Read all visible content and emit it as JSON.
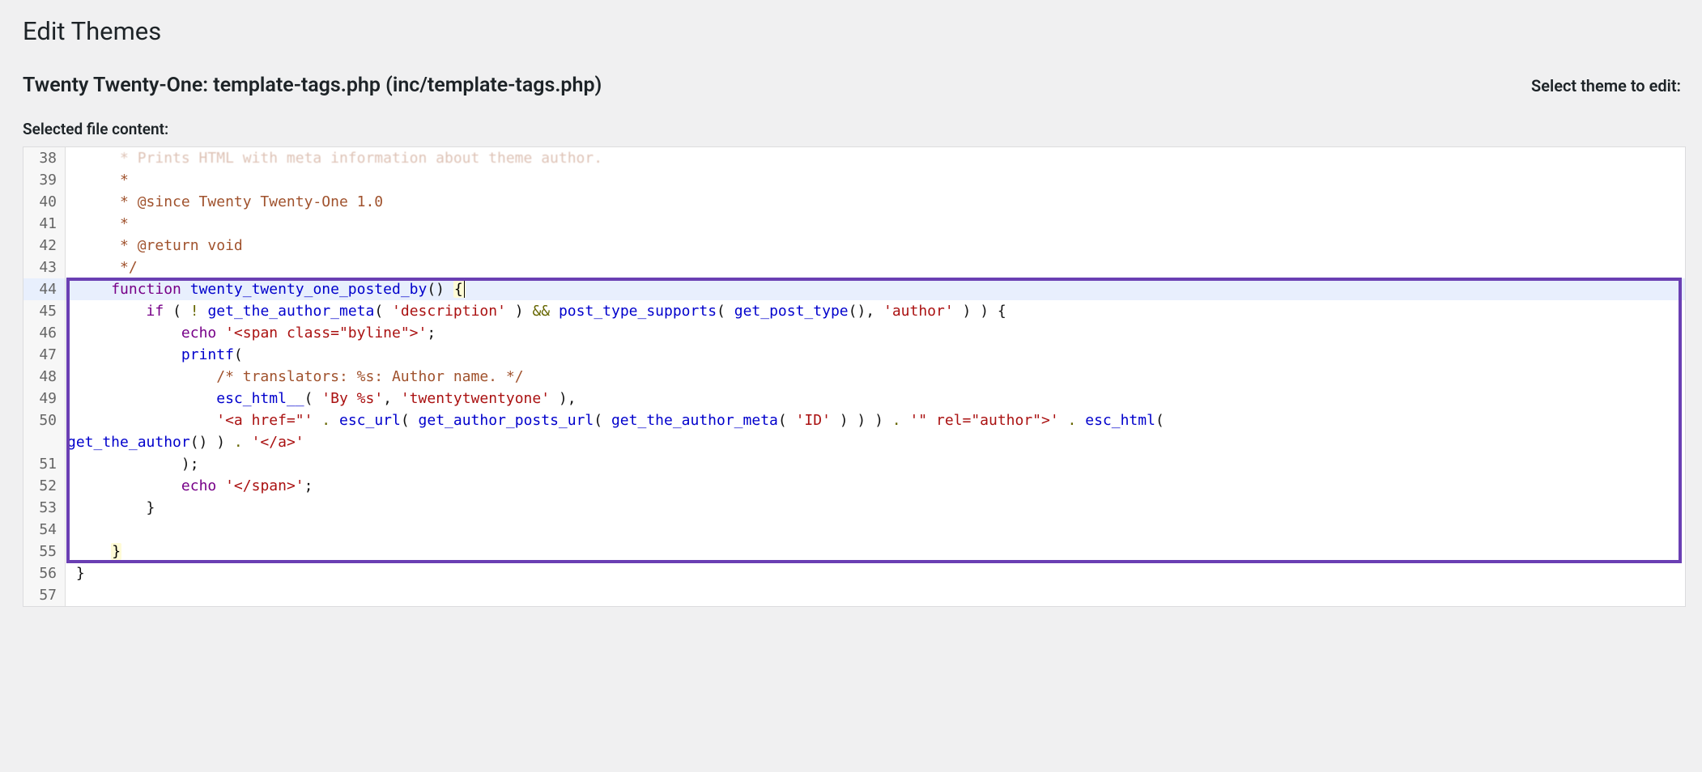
{
  "page": {
    "title": "Edit Themes",
    "file_header": "Twenty Twenty-One: template-tags.php (inc/template-tags.php)",
    "select_theme_label": "Select theme to edit:",
    "selected_file_label": "Selected file content:"
  },
  "editor": {
    "first_visible_line": 38,
    "highlighted_line": 44,
    "annotation_lines": {
      "start": 44,
      "end": 55
    },
    "lines": [
      {
        "n": 38,
        "partial_top": true,
        "segments": [
          {
            "cls": "c-doc",
            "t": "      * Prints HTML with meta information about theme author."
          }
        ]
      },
      {
        "n": 39,
        "segments": [
          {
            "cls": "c-doc",
            "t": "      *"
          }
        ]
      },
      {
        "n": 40,
        "segments": [
          {
            "cls": "c-doc",
            "t": "      * @since Twenty Twenty-One 1.0"
          }
        ]
      },
      {
        "n": 41,
        "segments": [
          {
            "cls": "c-doc",
            "t": "      *"
          }
        ]
      },
      {
        "n": 42,
        "segments": [
          {
            "cls": "c-doc",
            "t": "      * @return void"
          }
        ]
      },
      {
        "n": 43,
        "segments": [
          {
            "cls": "c-doc",
            "t": "      */"
          }
        ]
      },
      {
        "n": 44,
        "segments": [
          {
            "cls": "c-def",
            "t": "     "
          },
          {
            "cls": "c-kw",
            "t": "function"
          },
          {
            "cls": "c-def",
            "t": " "
          },
          {
            "cls": "c-fn",
            "t": "twenty_twenty_one_posted_by"
          },
          {
            "cls": "c-def",
            "t": "() "
          },
          {
            "cls": "c-brace-m",
            "t": "{",
            "cursor_after": true
          }
        ]
      },
      {
        "n": 45,
        "segments": [
          {
            "cls": "c-def",
            "t": "         "
          },
          {
            "cls": "c-kw",
            "t": "if"
          },
          {
            "cls": "c-def",
            "t": " ( "
          },
          {
            "cls": "c-op",
            "t": "!"
          },
          {
            "cls": "c-def",
            "t": " "
          },
          {
            "cls": "c-fn",
            "t": "get_the_author_meta"
          },
          {
            "cls": "c-def",
            "t": "( "
          },
          {
            "cls": "c-str",
            "t": "'description'"
          },
          {
            "cls": "c-def",
            "t": " ) "
          },
          {
            "cls": "c-op",
            "t": "&&"
          },
          {
            "cls": "c-def",
            "t": " "
          },
          {
            "cls": "c-fn",
            "t": "post_type_supports"
          },
          {
            "cls": "c-def",
            "t": "( "
          },
          {
            "cls": "c-fn",
            "t": "get_post_type"
          },
          {
            "cls": "c-def",
            "t": "(), "
          },
          {
            "cls": "c-str",
            "t": "'author'"
          },
          {
            "cls": "c-def",
            "t": " ) ) {"
          }
        ]
      },
      {
        "n": 46,
        "segments": [
          {
            "cls": "c-def",
            "t": "             "
          },
          {
            "cls": "c-kw",
            "t": "echo"
          },
          {
            "cls": "c-def",
            "t": " "
          },
          {
            "cls": "c-str",
            "t": "'<span class=\"byline\">'"
          },
          {
            "cls": "c-def",
            "t": ";"
          }
        ]
      },
      {
        "n": 47,
        "segments": [
          {
            "cls": "c-def",
            "t": "             "
          },
          {
            "cls": "c-fn",
            "t": "printf"
          },
          {
            "cls": "c-def",
            "t": "("
          }
        ]
      },
      {
        "n": 48,
        "segments": [
          {
            "cls": "c-def",
            "t": "                 "
          },
          {
            "cls": "c-cmt",
            "t": "/* translators: %s: Author name. */"
          }
        ]
      },
      {
        "n": 49,
        "segments": [
          {
            "cls": "c-def",
            "t": "                 "
          },
          {
            "cls": "c-fn",
            "t": "esc_html__"
          },
          {
            "cls": "c-def",
            "t": "( "
          },
          {
            "cls": "c-str",
            "t": "'By %s'"
          },
          {
            "cls": "c-def",
            "t": ", "
          },
          {
            "cls": "c-str",
            "t": "'twentytwentyone'"
          },
          {
            "cls": "c-def",
            "t": " ),"
          }
        ]
      },
      {
        "n": 50,
        "wrap": true,
        "segments": [
          {
            "cls": "c-def",
            "t": "                 "
          },
          {
            "cls": "c-str",
            "t": "'<a href=\"'"
          },
          {
            "cls": "c-def",
            "t": " "
          },
          {
            "cls": "c-op",
            "t": "."
          },
          {
            "cls": "c-def",
            "t": " "
          },
          {
            "cls": "c-fn",
            "t": "esc_url"
          },
          {
            "cls": "c-def",
            "t": "( "
          },
          {
            "cls": "c-fn",
            "t": "get_author_posts_url"
          },
          {
            "cls": "c-def",
            "t": "( "
          },
          {
            "cls": "c-fn",
            "t": "get_the_author_meta"
          },
          {
            "cls": "c-def",
            "t": "( "
          },
          {
            "cls": "c-str",
            "t": "'ID'"
          },
          {
            "cls": "c-def",
            "t": " ) ) ) "
          },
          {
            "cls": "c-op",
            "t": "."
          },
          {
            "cls": "c-def",
            "t": " "
          },
          {
            "cls": "c-str",
            "t": "'\" rel=\"author\">'"
          },
          {
            "cls": "c-def",
            "t": " "
          },
          {
            "cls": "c-op",
            "t": "."
          },
          {
            "cls": "c-def",
            "t": " "
          },
          {
            "cls": "c-fn",
            "t": "esc_html"
          },
          {
            "cls": "c-def",
            "t": "( "
          }
        ],
        "wrap_segments": [
          {
            "cls": "c-fn",
            "t": "get_the_author"
          },
          {
            "cls": "c-def",
            "t": "() ) "
          },
          {
            "cls": "c-op",
            "t": "."
          },
          {
            "cls": "c-def",
            "t": " "
          },
          {
            "cls": "c-str",
            "t": "'</a>'"
          }
        ]
      },
      {
        "n": 51,
        "segments": [
          {
            "cls": "c-def",
            "t": "             );"
          }
        ]
      },
      {
        "n": 52,
        "segments": [
          {
            "cls": "c-def",
            "t": "             "
          },
          {
            "cls": "c-kw",
            "t": "echo"
          },
          {
            "cls": "c-def",
            "t": " "
          },
          {
            "cls": "c-str",
            "t": "'</span>'"
          },
          {
            "cls": "c-def",
            "t": ";"
          }
        ]
      },
      {
        "n": 53,
        "segments": [
          {
            "cls": "c-def",
            "t": "         }"
          }
        ]
      },
      {
        "n": 54,
        "segments": [
          {
            "cls": "c-def",
            "t": ""
          }
        ]
      },
      {
        "n": 55,
        "segments": [
          {
            "cls": "c-def",
            "t": "     "
          },
          {
            "cls": "c-brace-m",
            "t": "}"
          }
        ]
      },
      {
        "n": 56,
        "segments": [
          {
            "cls": "c-def",
            "t": " }"
          }
        ]
      },
      {
        "n": 57,
        "partial_bottom": true,
        "segments": [
          {
            "cls": "c-def",
            "t": ""
          }
        ]
      }
    ]
  }
}
